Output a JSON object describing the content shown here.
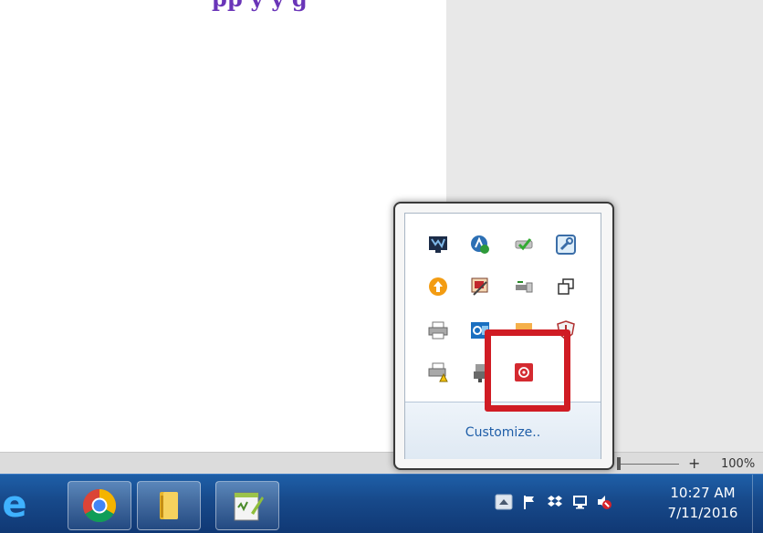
{
  "document": {
    "heading_fragment": "pp                    y            y                         g"
  },
  "statusbar": {
    "zoom_plus": "+",
    "zoom_percent": "100%"
  },
  "taskbar": {
    "pinned": [
      {
        "name": "internet-explorer",
        "icon": "ie-icon"
      },
      {
        "name": "chrome",
        "icon": "chrome-icon"
      },
      {
        "name": "file-explorer",
        "icon": "folder-icon"
      },
      {
        "name": "notepad-plus-plus",
        "icon": "notepad-icon"
      }
    ],
    "tray_icons": [
      "show-hidden-icons-arrow",
      "action-center-flag-icon",
      "dropbox-icon",
      "network-icon",
      "volume-muted-icon"
    ],
    "clock": {
      "time": "10:27 AM",
      "date": "7/11/2016"
    }
  },
  "flyout": {
    "customize_label": "Customize..",
    "icons": [
      [
        "monitor-app-icon",
        "azure-icon",
        "tick-drive-icon",
        "wrench-tool-icon"
      ],
      [
        "orange-update-icon",
        "picture-app-icon",
        "usb-safely-remove-icon",
        "copy-windows-icon"
      ],
      [
        "printer-icon",
        "outlook-icon",
        "orange-sync-icon",
        "defender-icon"
      ],
      [
        "printer-warning-icon",
        "usb-plug-icon",
        "red-circle-app-icon"
      ]
    ],
    "highlight_color": "#d01c24"
  }
}
